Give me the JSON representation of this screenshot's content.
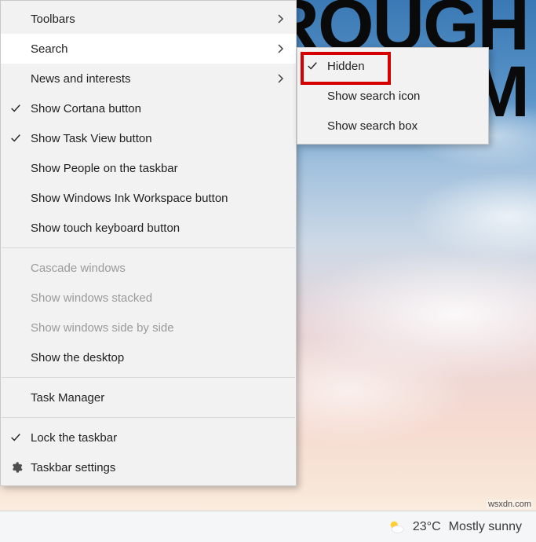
{
  "wallpaper": {
    "line1": "HROUGH",
    "line2": "M"
  },
  "menu": {
    "items": [
      {
        "label": "Toolbars",
        "checked": false,
        "arrow": true,
        "disabled": false,
        "hover": false,
        "icon": null
      },
      {
        "label": "Search",
        "checked": false,
        "arrow": true,
        "disabled": false,
        "hover": true,
        "icon": null
      },
      {
        "label": "News and interests",
        "checked": false,
        "arrow": true,
        "disabled": false,
        "hover": false,
        "icon": null
      },
      {
        "label": "Show Cortana button",
        "checked": true,
        "arrow": false,
        "disabled": false,
        "hover": false,
        "icon": null
      },
      {
        "label": "Show Task View button",
        "checked": true,
        "arrow": false,
        "disabled": false,
        "hover": false,
        "icon": null
      },
      {
        "label": "Show People on the taskbar",
        "checked": false,
        "arrow": false,
        "disabled": false,
        "hover": false,
        "icon": null
      },
      {
        "label": "Show Windows Ink Workspace button",
        "checked": false,
        "arrow": false,
        "disabled": false,
        "hover": false,
        "icon": null
      },
      {
        "label": "Show touch keyboard button",
        "checked": false,
        "arrow": false,
        "disabled": false,
        "hover": false,
        "icon": null
      },
      {
        "sep": true
      },
      {
        "label": "Cascade windows",
        "checked": false,
        "arrow": false,
        "disabled": true,
        "hover": false,
        "icon": null
      },
      {
        "label": "Show windows stacked",
        "checked": false,
        "arrow": false,
        "disabled": true,
        "hover": false,
        "icon": null
      },
      {
        "label": "Show windows side by side",
        "checked": false,
        "arrow": false,
        "disabled": true,
        "hover": false,
        "icon": null
      },
      {
        "label": "Show the desktop",
        "checked": false,
        "arrow": false,
        "disabled": false,
        "hover": false,
        "icon": null
      },
      {
        "sep": true
      },
      {
        "label": "Task Manager",
        "checked": false,
        "arrow": false,
        "disabled": false,
        "hover": false,
        "icon": null
      },
      {
        "sep": true
      },
      {
        "label": "Lock the taskbar",
        "checked": true,
        "arrow": false,
        "disabled": false,
        "hover": false,
        "icon": null
      },
      {
        "label": "Taskbar settings",
        "checked": false,
        "arrow": false,
        "disabled": false,
        "hover": false,
        "icon": "gear"
      }
    ]
  },
  "submenu": {
    "items": [
      {
        "label": "Hidden",
        "checked": true
      },
      {
        "label": "Show search icon",
        "checked": false
      },
      {
        "label": "Show search box",
        "checked": false
      }
    ]
  },
  "taskbar": {
    "temp": "23°C",
    "condition": "Mostly sunny"
  },
  "watermark": "wsxdn.com"
}
